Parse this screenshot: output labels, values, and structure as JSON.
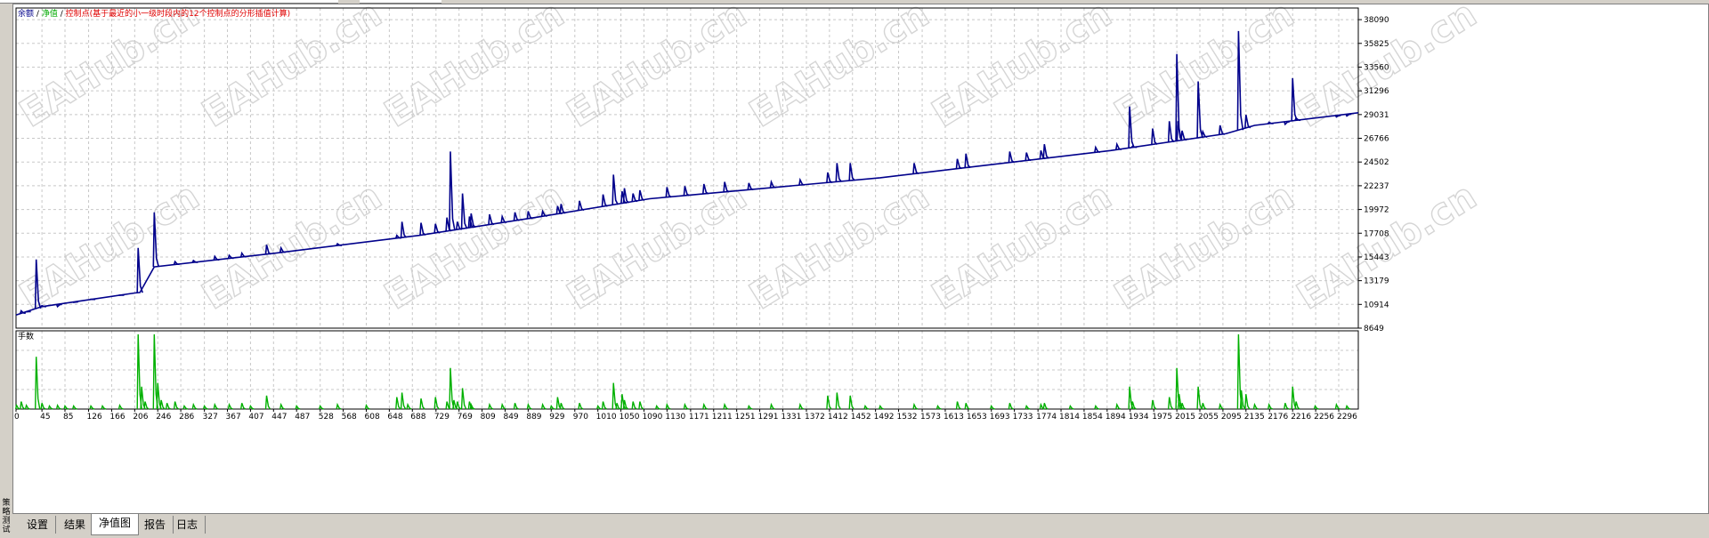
{
  "window": {
    "sidebar_label": "策略测试"
  },
  "legend": {
    "balance": "余额",
    "sep1": "/",
    "equity": "净值",
    "sep2": "/",
    "checkpoints": "控制点(基于最近的小一级时段内的12个控制点的分形插值计算)"
  },
  "lots_label": "手数",
  "watermark_text": "EAHub.cn",
  "tabs": [
    {
      "label": "设置",
      "active": false
    },
    {
      "label": "结果",
      "active": false
    },
    {
      "label": "净值图",
      "active": true
    },
    {
      "label": "报告",
      "active": false
    },
    {
      "label": "日志",
      "active": false
    }
  ],
  "colors": {
    "balance_line": "#00008b",
    "equity_legend": "#00aa00",
    "checkpoint_legend": "#e00000",
    "lots_bars": "#00b000",
    "grid": "#c8c8c8"
  },
  "chart_data": {
    "type": "line",
    "y_axis_ticks": [
      "38090",
      "35825",
      "33560",
      "31296",
      "29031",
      "26766",
      "24502",
      "22237",
      "19972",
      "17708",
      "15443",
      "13179",
      "10914",
      "8649"
    ],
    "x_axis_ticks": [
      "0",
      "45",
      "85",
      "126",
      "166",
      "206",
      "246",
      "286",
      "327",
      "367",
      "407",
      "447",
      "487",
      "528",
      "568",
      "608",
      "648",
      "688",
      "729",
      "769",
      "809",
      "849",
      "889",
      "929",
      "970",
      "1010",
      "1050",
      "1090",
      "1130",
      "1171",
      "1211",
      "1251",
      "1291",
      "1331",
      "1372",
      "1412",
      "1452",
      "1492",
      "1532",
      "1573",
      "1613",
      "1653",
      "1693",
      "1733",
      "1774",
      "1814",
      "1854",
      "1894",
      "1934",
      "1975",
      "2015",
      "2055",
      "2095",
      "2135",
      "2176",
      "2216",
      "2256",
      "2296"
    ],
    "x_range": [
      0,
      2330
    ],
    "y_range": [
      8649,
      39200
    ],
    "grid": true,
    "series": [
      {
        "name": "余额",
        "baseline": [
          [
            0,
            9900
          ],
          [
            45,
            10700
          ],
          [
            206,
            12000
          ],
          [
            215,
            12050
          ],
          [
            240,
            14500
          ],
          [
            450,
            15800
          ],
          [
            700,
            17500
          ],
          [
            900,
            19200
          ],
          [
            1100,
            21000
          ],
          [
            1300,
            22000
          ],
          [
            1500,
            23000
          ],
          [
            1700,
            24300
          ],
          [
            1900,
            25600
          ],
          [
            2100,
            27200
          ],
          [
            2150,
            28000
          ],
          [
            2330,
            29200
          ]
        ],
        "spikes": [
          [
            9,
            10300
          ],
          [
            18,
            10200
          ],
          [
            35,
            15200
          ],
          [
            45,
            10800
          ],
          [
            72,
            10700
          ],
          [
            100,
            11100
          ],
          [
            130,
            11400
          ],
          [
            180,
            11800
          ],
          [
            212,
            16300
          ],
          [
            240,
            19700
          ],
          [
            276,
            15000
          ],
          [
            308,
            15100
          ],
          [
            345,
            15500
          ],
          [
            370,
            15600
          ],
          [
            392,
            15800
          ],
          [
            435,
            16600
          ],
          [
            460,
            16300
          ],
          [
            558,
            16700
          ],
          [
            661,
            17500
          ],
          [
            670,
            18800
          ],
          [
            703,
            18700
          ],
          [
            728,
            18600
          ],
          [
            748,
            19200
          ],
          [
            754,
            25500
          ],
          [
            766,
            18800
          ],
          [
            775,
            21500
          ],
          [
            787,
            19300
          ],
          [
            790,
            19600
          ],
          [
            822,
            19500
          ],
          [
            844,
            19300
          ],
          [
            866,
            19700
          ],
          [
            889,
            19800
          ],
          [
            914,
            19800
          ],
          [
            940,
            20300
          ],
          [
            946,
            20500
          ],
          [
            978,
            20800
          ],
          [
            1019,
            21400
          ],
          [
            1037,
            23300
          ],
          [
            1052,
            21700
          ],
          [
            1056,
            22000
          ],
          [
            1071,
            21500
          ],
          [
            1083,
            21800
          ],
          [
            1130,
            22100
          ],
          [
            1161,
            22200
          ],
          [
            1194,
            22400
          ],
          [
            1230,
            22600
          ],
          [
            1272,
            22500
          ],
          [
            1311,
            22600
          ],
          [
            1361,
            22800
          ],
          [
            1409,
            23500
          ],
          [
            1425,
            24400
          ],
          [
            1448,
            24400
          ],
          [
            1559,
            24400
          ],
          [
            1634,
            24800
          ],
          [
            1649,
            25300
          ],
          [
            1725,
            25500
          ],
          [
            1754,
            25400
          ],
          [
            1779,
            25600
          ],
          [
            1785,
            26200
          ],
          [
            1874,
            25900
          ],
          [
            1911,
            26200
          ],
          [
            1933,
            29800
          ],
          [
            1938,
            26000
          ],
          [
            1973,
            27700
          ],
          [
            2002,
            28400
          ],
          [
            2015,
            34800
          ],
          [
            2017,
            28400
          ],
          [
            2024,
            27500
          ],
          [
            2052,
            32200
          ],
          [
            2060,
            27400
          ],
          [
            2090,
            28000
          ],
          [
            2122,
            37000
          ],
          [
            2135,
            29000
          ],
          [
            2175,
            28300
          ],
          [
            2203,
            28100
          ],
          [
            2216,
            32500
          ],
          [
            2222,
            28700
          ],
          [
            2292,
            28800
          ],
          [
            2310,
            28900
          ]
        ]
      }
    ],
    "lots": {
      "label": "手数",
      "bars": [
        [
          1,
          0.05
        ],
        [
          9,
          0.1
        ],
        [
          18,
          0.05
        ],
        [
          35,
          0.7
        ],
        [
          45,
          0.08
        ],
        [
          58,
          0.04
        ],
        [
          72,
          0.05
        ],
        [
          85,
          0.04
        ],
        [
          100,
          0.04
        ],
        [
          130,
          0.04
        ],
        [
          150,
          0.04
        ],
        [
          180,
          0.05
        ],
        [
          212,
          1.0
        ],
        [
          218,
          0.3
        ],
        [
          224,
          0.1
        ],
        [
          240,
          1.0
        ],
        [
          246,
          0.35
        ],
        [
          252,
          0.12
        ],
        [
          262,
          0.08
        ],
        [
          276,
          0.1
        ],
        [
          292,
          0.04
        ],
        [
          308,
          0.06
        ],
        [
          327,
          0.04
        ],
        [
          345,
          0.06
        ],
        [
          370,
          0.06
        ],
        [
          392,
          0.08
        ],
        [
          407,
          0.04
        ],
        [
          435,
          0.18
        ],
        [
          460,
          0.06
        ],
        [
          487,
          0.04
        ],
        [
          528,
          0.04
        ],
        [
          558,
          0.06
        ],
        [
          608,
          0.05
        ],
        [
          661,
          0.16
        ],
        [
          670,
          0.22
        ],
        [
          680,
          0.06
        ],
        [
          703,
          0.14
        ],
        [
          728,
          0.16
        ],
        [
          748,
          0.1
        ],
        [
          754,
          0.55
        ],
        [
          760,
          0.12
        ],
        [
          766,
          0.1
        ],
        [
          775,
          0.28
        ],
        [
          787,
          0.1
        ],
        [
          790,
          0.06
        ],
        [
          822,
          0.06
        ],
        [
          844,
          0.06
        ],
        [
          866,
          0.08
        ],
        [
          889,
          0.06
        ],
        [
          914,
          0.06
        ],
        [
          929,
          0.04
        ],
        [
          940,
          0.16
        ],
        [
          946,
          0.08
        ],
        [
          978,
          0.08
        ],
        [
          1010,
          0.04
        ],
        [
          1019,
          0.1
        ],
        [
          1037,
          0.35
        ],
        [
          1043,
          0.08
        ],
        [
          1052,
          0.2
        ],
        [
          1056,
          0.12
        ],
        [
          1071,
          0.1
        ],
        [
          1083,
          0.1
        ],
        [
          1112,
          0.04
        ],
        [
          1130,
          0.06
        ],
        [
          1161,
          0.06
        ],
        [
          1194,
          0.06
        ],
        [
          1230,
          0.06
        ],
        [
          1272,
          0.04
        ],
        [
          1311,
          0.06
        ],
        [
          1361,
          0.06
        ],
        [
          1409,
          0.18
        ],
        [
          1425,
          0.22
        ],
        [
          1448,
          0.18
        ],
        [
          1474,
          0.04
        ],
        [
          1500,
          0.04
        ],
        [
          1559,
          0.06
        ],
        [
          1600,
          0.04
        ],
        [
          1634,
          0.1
        ],
        [
          1649,
          0.08
        ],
        [
          1693,
          0.04
        ],
        [
          1725,
          0.08
        ],
        [
          1754,
          0.04
        ],
        [
          1779,
          0.06
        ],
        [
          1785,
          0.08
        ],
        [
          1830,
          0.04
        ],
        [
          1874,
          0.04
        ],
        [
          1911,
          0.06
        ],
        [
          1933,
          0.3
        ],
        [
          1938,
          0.1
        ],
        [
          1973,
          0.12
        ],
        [
          2002,
          0.16
        ],
        [
          2015,
          0.55
        ],
        [
          2019,
          0.2
        ],
        [
          2024,
          0.08
        ],
        [
          2052,
          0.3
        ],
        [
          2060,
          0.08
        ],
        [
          2090,
          0.06
        ],
        [
          2122,
          1.0
        ],
        [
          2127,
          0.25
        ],
        [
          2135,
          0.2
        ],
        [
          2150,
          0.06
        ],
        [
          2175,
          0.06
        ],
        [
          2203,
          0.08
        ],
        [
          2216,
          0.3
        ],
        [
          2222,
          0.1
        ],
        [
          2255,
          0.04
        ],
        [
          2292,
          0.06
        ],
        [
          2310,
          0.04
        ]
      ]
    }
  }
}
